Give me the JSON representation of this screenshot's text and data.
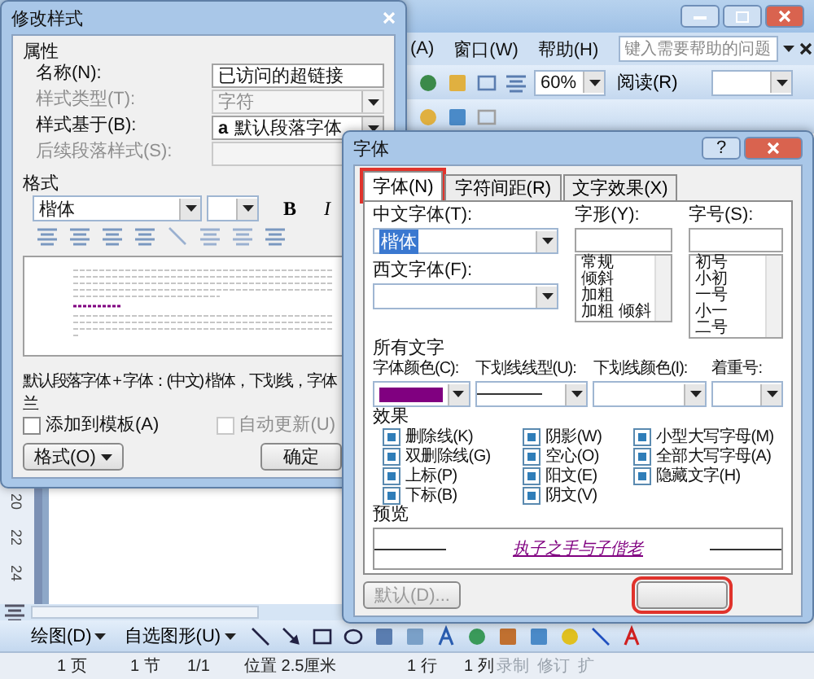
{
  "word": {
    "menu": [
      {
        "label": "(A)"
      },
      {
        "label": "窗口(W)"
      },
      {
        "label": "帮助(H)"
      }
    ],
    "help_search": {
      "placeholder": "键入需要帮助的问题"
    },
    "zoom": "60%",
    "read_button": "阅读(R)",
    "ruler_numbers": [
      "20",
      "22",
      "24"
    ],
    "draw_menu": "绘图(D)",
    "autoshapes_menu": "自选图形(U)",
    "status": [
      {
        "text": "1 页",
        "disabled": false
      },
      {
        "text": "1 节",
        "disabled": false
      },
      {
        "text": "1/1",
        "disabled": false
      },
      {
        "text": "位置 2.5厘米",
        "disabled": false
      },
      {
        "text": "1 行",
        "disabled": false
      },
      {
        "text": "1 列",
        "disabled": false
      },
      {
        "text": "录制",
        "disabled": true
      },
      {
        "text": "修订",
        "disabled": true
      },
      {
        "text": "扩",
        "disabled": true
      }
    ]
  },
  "modify_dialog": {
    "title": "修改样式",
    "properties_label": "属性",
    "fields": [
      {
        "label": "名称(N):",
        "value": "已访问的超链接",
        "kind": "text",
        "disabled": false
      },
      {
        "label": "样式类型(T):",
        "value": "字符",
        "kind": "select",
        "disabled": true
      },
      {
        "label": "样式基于(B):",
        "prefix": "a",
        "value": "默认段落字体",
        "kind": "select",
        "disabled": false
      },
      {
        "label": "后续段落样式(S):",
        "kind": "select",
        "disabled": true
      }
    ],
    "format_label": "格式",
    "font": "楷体",
    "bold": "B",
    "italic": "I",
    "description": [
      "默认段落字体 + 字体：(中文) 楷体，下划线，字体",
      "兰"
    ],
    "checkboxes": [
      {
        "label": "添加到模板(A)",
        "checked": false,
        "disabled": false
      },
      {
        "label": "自动更新(U)",
        "checked": false,
        "disabled": true
      }
    ],
    "format_button": "格式(O)",
    "ok_button": "确定"
  },
  "font_dialog": {
    "title": "字体",
    "help": "?",
    "tabs": [
      {
        "label": "字体(N)",
        "selected": true,
        "marked": true
      },
      {
        "label": "字符间距(R)",
        "selected": false,
        "marked": false
      },
      {
        "label": "文字效果(X)",
        "selected": false,
        "marked": false
      }
    ],
    "chinese_font": {
      "label": "中文字体(T):",
      "value": "楷体"
    },
    "western_font": {
      "label": "西文字体(F):"
    },
    "style": {
      "label": "字形(Y):",
      "options": [
        "常规",
        "倾斜",
        "加粗",
        "加粗 倾斜"
      ]
    },
    "size": {
      "label": "字号(S):",
      "options": [
        "初号",
        "小初",
        "一号",
        "小一",
        "二号"
      ]
    },
    "all_text_label": "所有文字",
    "combos": [
      {
        "label": "字体颜色(C):",
        "kind": "color",
        "color": "#800080"
      },
      {
        "label": "下划线线型(U):",
        "kind": "line"
      },
      {
        "label": "下划线颜色(I):",
        "kind": "empty"
      },
      {
        "label": "着重号:",
        "kind": "empty"
      }
    ],
    "effects_label": "效果",
    "effects": [
      [
        {
          "label": "删除线(K)",
          "indeterminate": true
        },
        {
          "label": "双删除线(G)",
          "indeterminate": true
        },
        {
          "label": "上标(P)",
          "indeterminate": true
        },
        {
          "label": "下标(B)",
          "indeterminate": true
        }
      ],
      [
        {
          "label": "阴影(W)",
          "indeterminate": true
        },
        {
          "label": "空心(O)",
          "indeterminate": true
        },
        {
          "label": "阳文(E)",
          "indeterminate": true
        },
        {
          "label": "阴文(V)",
          "indeterminate": true
        }
      ],
      [
        {
          "label": "小型大写字母(M)",
          "indeterminate": true
        },
        {
          "label": "全部大写字母(A)",
          "indeterminate": true
        },
        {
          "label": "隐藏文字(H)",
          "indeterminate": true
        }
      ]
    ],
    "preview_label": "预览",
    "preview_text": "执子之手与子偕老",
    "default_button": {
      "label": "默认(D)...",
      "disabled": true
    },
    "ok_button": {
      "marked": true
    }
  }
}
